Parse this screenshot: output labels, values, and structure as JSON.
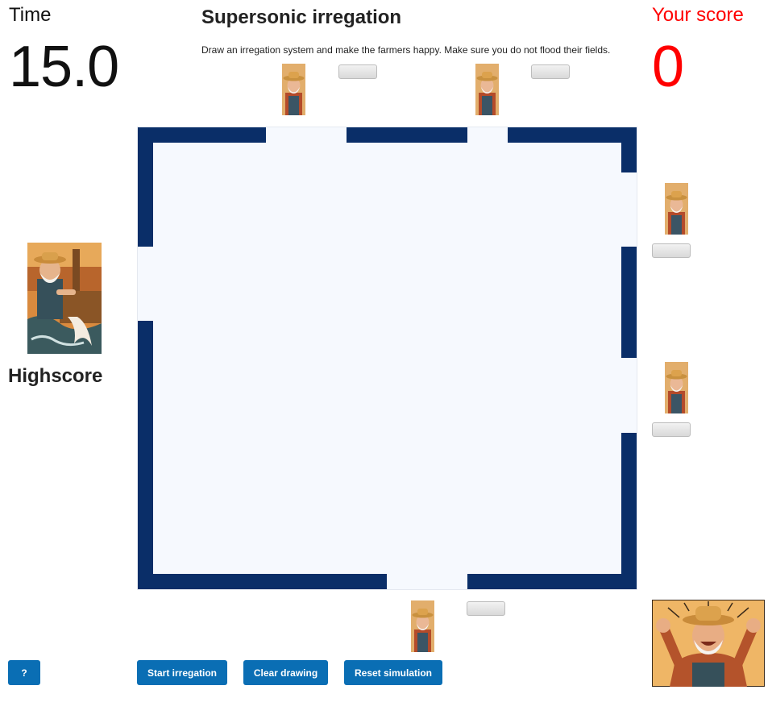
{
  "time": {
    "label": "Time",
    "value": "15.0"
  },
  "header": {
    "title": "Supersonic irregation",
    "subtitle": "Draw an irregation system and make the farmers happy. Make sure you do not flood their fields."
  },
  "score": {
    "label": "Your score",
    "value": "0"
  },
  "highscore": {
    "label": "Highscore"
  },
  "buttons": {
    "help": "?",
    "start": "Start irregation",
    "clear": "Clear drawing",
    "reset": "Reset simulation"
  },
  "farmers": [
    {
      "position": "top-left",
      "satisfaction": 0
    },
    {
      "position": "top-right",
      "satisfaction": 0
    },
    {
      "position": "right-upper",
      "satisfaction": 0
    },
    {
      "position": "right-lower",
      "satisfaction": 0
    },
    {
      "position": "bottom",
      "satisfaction": 0
    }
  ],
  "colors": {
    "wall": "#0a2e68",
    "field": "#f6f9fe",
    "button": "#0a6eb4",
    "score": "#ff0000"
  },
  "icons": {
    "farmer": "farmer-portrait",
    "irrigation": "farmer-irrigation-illustration",
    "happy": "happy-farmer-illustration"
  }
}
